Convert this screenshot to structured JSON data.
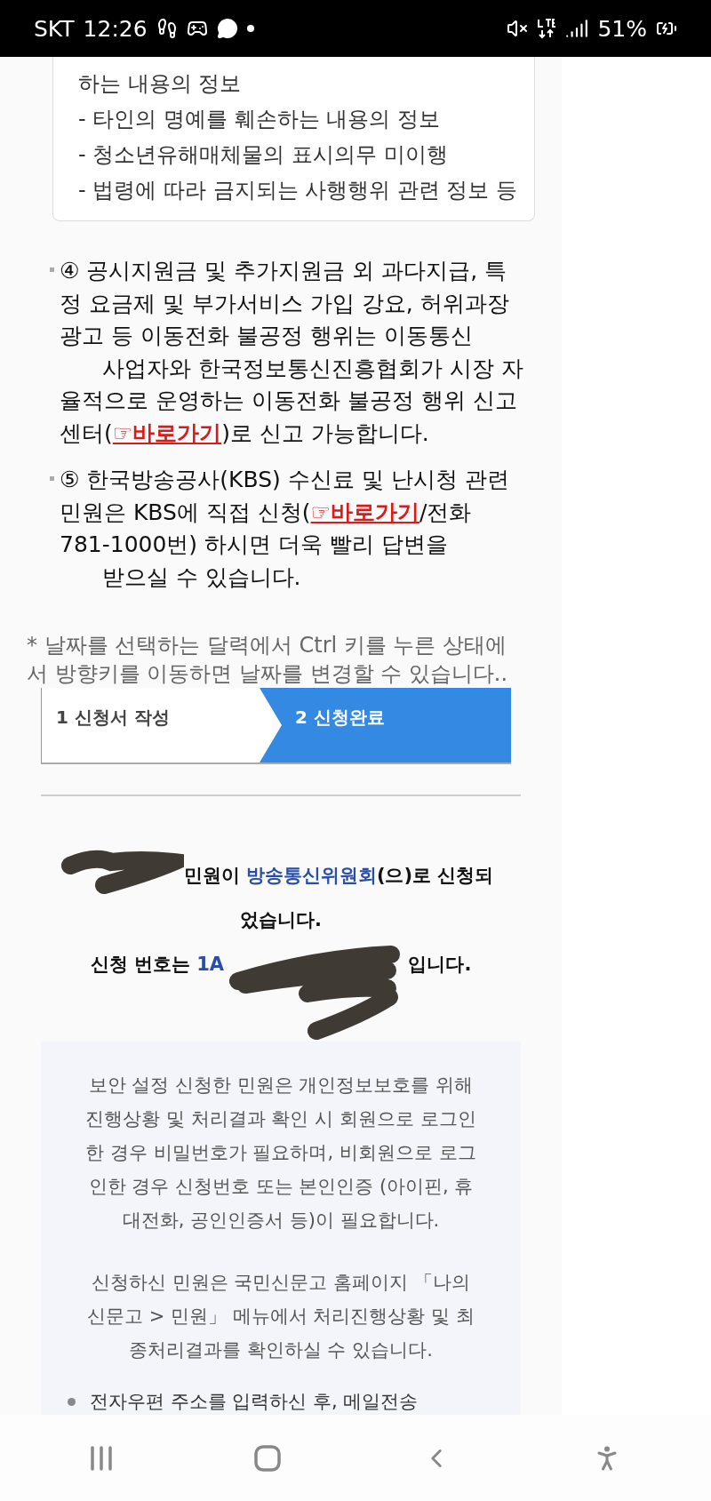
{
  "status_bar": {
    "carrier": "SKT",
    "time": "12:26",
    "battery": "51%"
  },
  "notice_box": {
    "lines": [
      "하는 내용의 정보",
      "- 타인의 명예를 훼손하는 내용의 정보",
      "- 청소년유해매체물의 표시의무 미이행",
      "- 법령에 따라 금지되는 사행행위 관련 정보 등"
    ]
  },
  "notes": [
    {
      "segments": [
        {
          "text": "④ 공시지원금 및 추가지원금 외 과다지급, 특\n정 요금제 및 부가서비스 가입 강요, 허위과장\n광고 등 이동전화 불공정 행위는 이동통신\n      사업자와 한국정보통신진흥협회가 시장 자\n율적으로 운영하는 이동전화 불공정 행위 신고\n센터("
        },
        {
          "link": "☞바로가기"
        },
        {
          "text": ")로 신고 가능합니다."
        }
      ]
    },
    {
      "segments": [
        {
          "text": "⑤ 한국방송공사(KBS) 수신료 및 난시청 관련\n민원은 KBS에 직접 신청("
        },
        {
          "link": "☞바로가기"
        },
        {
          "text": "/전화\n781-1000번) 하시면 더욱 빨리 답변을\n      받으실 수 있습니다."
        }
      ]
    }
  ],
  "calendar_hint": "* 날짜를 선택하는 달력에서 Ctrl 키를 누른 상태에\n서 방향키를 이동하면 날짜를 변경할 수 있습니다..",
  "steps": [
    {
      "label": "1 신청서 작성",
      "selected": false
    },
    {
      "label": "2 신청완료",
      "selected": true
    }
  ],
  "result": {
    "line1_before": "민원이 ",
    "agency": "방송통신위원회",
    "line1_after": "(으)로 신청되\n었습니다.",
    "number_label": "신청 번호는 ",
    "number": "1A",
    "number_after": " 입니다."
  },
  "info": {
    "paragraphs": [
      "보안 설정 신청한 민원은 개인정보보호를 위해\n진행상황 및 처리결과 확인 시 회원으로 로그인\n한 경우 비밀번호가 필요하며, 비회원으로 로그\n인한 경우 신청번호 또는 본인인증 (아이핀, 휴\n대전화, 공인인증서 등)이 필요합니다.",
      "신청하신 민원은 국민신문고 홈페이지 「나의\n신문고 > 민원」 메뉴에서 처리진행상황 및 최\n종처리결과를 확인하실 수 있습니다."
    ],
    "bullets": [
      "전자우편 주소를 입력하신 후, 메일전송"
    ]
  }
}
